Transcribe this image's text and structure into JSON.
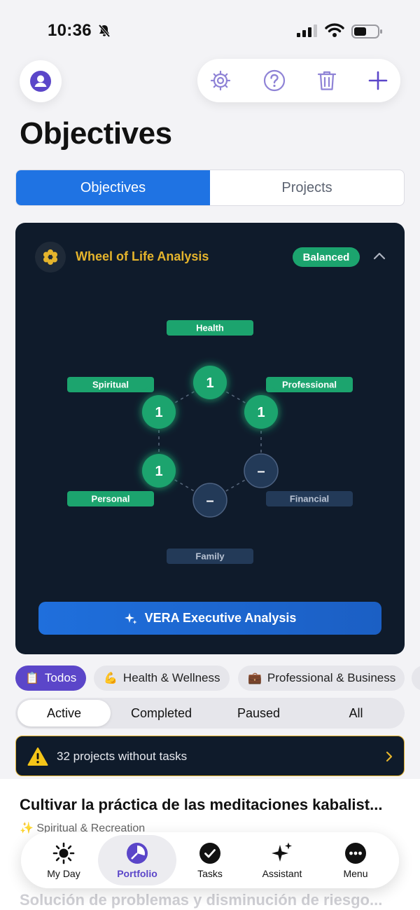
{
  "status_bar": {
    "time": "10:36"
  },
  "header": {
    "title": "Objectives"
  },
  "segment": {
    "tabs": [
      "Objectives",
      "Projects"
    ]
  },
  "wheel": {
    "title": "Wheel of Life Analysis",
    "badge": "Balanced",
    "areas": [
      {
        "label": "Health",
        "value": "1",
        "active": true
      },
      {
        "label": "Professional",
        "value": "1",
        "active": true
      },
      {
        "label": "Financial",
        "value": "–",
        "active": false
      },
      {
        "label": "Family",
        "value": "–",
        "active": false
      },
      {
        "label": "Personal",
        "value": "1",
        "active": true
      },
      {
        "label": "Spiritual",
        "value": "1",
        "active": true
      }
    ],
    "colors": {
      "active": "#1ca46e",
      "inactive": "#233a58",
      "card": "#0f1b2b",
      "title": "#e5b42c"
    },
    "cta": "VERA Executive Analysis"
  },
  "categories": [
    {
      "icon": "📋",
      "label": "Todos"
    },
    {
      "icon": "💪",
      "label": "Health & Wellness"
    },
    {
      "icon": "💼",
      "label": "Professional & Business"
    }
  ],
  "status_filters": [
    "Active",
    "Completed",
    "Paused",
    "All"
  ],
  "warning": {
    "text": "32 projects without tasks"
  },
  "list": [
    {
      "title": "Cultivar la práctica de las meditaciones kabalist...",
      "category": "✨ Spiritual & Recreation"
    },
    {
      "title": "Solución de problemas y disminución de riesgo..."
    }
  ],
  "tabbar": [
    "My Day",
    "Portfolio",
    "Tasks",
    "Assistant",
    "Menu"
  ]
}
